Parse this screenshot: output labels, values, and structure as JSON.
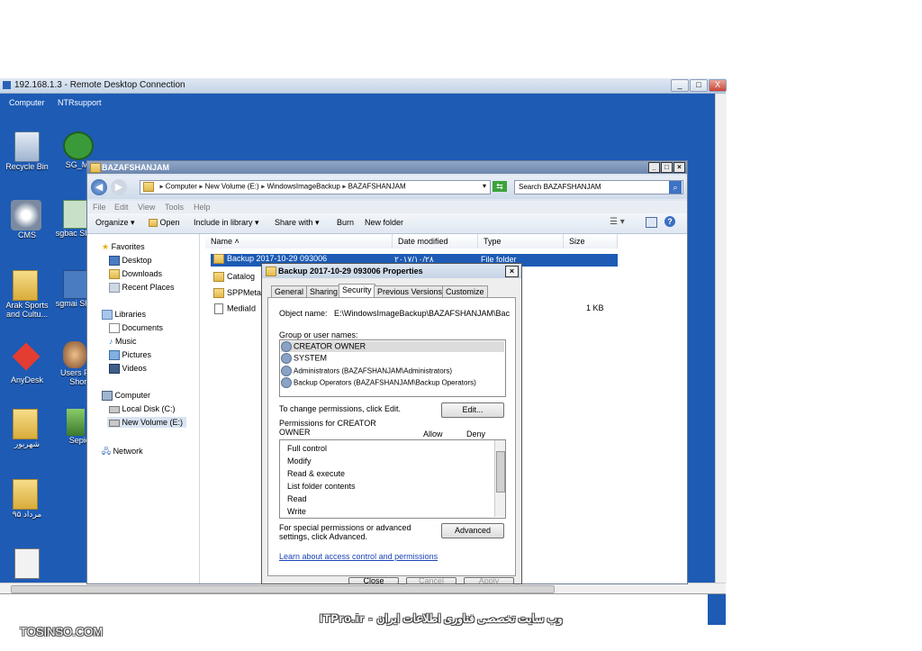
{
  "rdp": {
    "title": "192.168.1.3 - Remote Desktop Connection",
    "min": "_",
    "max": "□",
    "close": "X"
  },
  "desktop": {
    "top_labels": [
      "Computer",
      "NTRsupport"
    ],
    "icons": [
      {
        "label": "Recycle Bin"
      },
      {
        "label": "SG_Mo"
      },
      {
        "label": "CMS"
      },
      {
        "label": "sgbac Shortc"
      },
      {
        "label": "Arak Sports and Cultu..."
      },
      {
        "label": "sgmai Shortc"
      },
      {
        "label": "AnyDesk"
      },
      {
        "label": "Users Fo - Short"
      },
      {
        "label": "شهریور"
      },
      {
        "label": "Sepic"
      },
      {
        "label": "مرداد ۹۵"
      }
    ]
  },
  "explorer": {
    "title": "BAZAFSHANJAM",
    "address": [
      "Computer",
      "New Volume (E:)",
      "WindowsImageBackup",
      "BAZAFSHANJAM"
    ],
    "search_placeholder": "Search BAZAFSHANJAM",
    "menu": [
      "File",
      "Edit",
      "View",
      "Tools",
      "Help"
    ],
    "toolbar": {
      "organize": "Organize",
      "open": "Open",
      "include": "Include in library",
      "share": "Share with",
      "burn": "Burn",
      "new_folder": "New folder"
    },
    "nav": {
      "favorites": "Favorites",
      "desktop": "Desktop",
      "downloads": "Downloads",
      "recent": "Recent Places",
      "libraries": "Libraries",
      "documents": "Documents",
      "music": "Music",
      "pictures": "Pictures",
      "videos": "Videos",
      "computer": "Computer",
      "local_disk": "Local Disk (C:)",
      "new_volume": "New Volume (E:)",
      "network": "Network"
    },
    "columns": {
      "name": "Name",
      "date": "Date modified",
      "type": "Type",
      "size": "Size"
    },
    "files": [
      {
        "name": "Backup 2017-10-29 093006",
        "date": "۲۰۱۷/۱۰/۲۸",
        "type": "File folder",
        "size": ""
      },
      {
        "name": "Catalog",
        "date": "",
        "type": "",
        "size": ""
      },
      {
        "name": "SPPMetad",
        "date": "",
        "type": "",
        "size": ""
      },
      {
        "name": "MediaId",
        "date": "",
        "type": "",
        "size": "1 KB"
      }
    ]
  },
  "dialog": {
    "title": "Backup 2017-10-29 093006 Properties",
    "tabs": [
      "General",
      "Sharing",
      "Security",
      "Previous Versions",
      "Customize"
    ],
    "object_label": "Object name:",
    "object_value": "E:\\WindowsImageBackup\\BAZAFSHANJAM\\Bac",
    "group_label": "Group or user names:",
    "users": [
      "CREATOR OWNER",
      "SYSTEM",
      "Administrators (BAZAFSHANJAM\\Administrators)",
      "Backup Operators (BAZAFSHANJAM\\Backup Operators)"
    ],
    "change_text": "To change permissions, click Edit.",
    "edit_button": "Edit...",
    "perm_for": "Permissions for CREATOR OWNER",
    "allow": "Allow",
    "deny": "Deny",
    "permissions": [
      "Full control",
      "Modify",
      "Read & execute",
      "List folder contents",
      "Read",
      "Write"
    ],
    "special_text": "For special permissions or advanced settings, click Advanced.",
    "advanced_button": "Advanced",
    "link": "Learn about access control and permissions",
    "close": "Close",
    "cancel": "Cancel",
    "apply": "Apply"
  },
  "overlay": {
    "watermark": "ITPro.ir - وب سایت تخصصی فناوری اطلاعات ایران",
    "tosinso": "TOSINSO.COM"
  }
}
